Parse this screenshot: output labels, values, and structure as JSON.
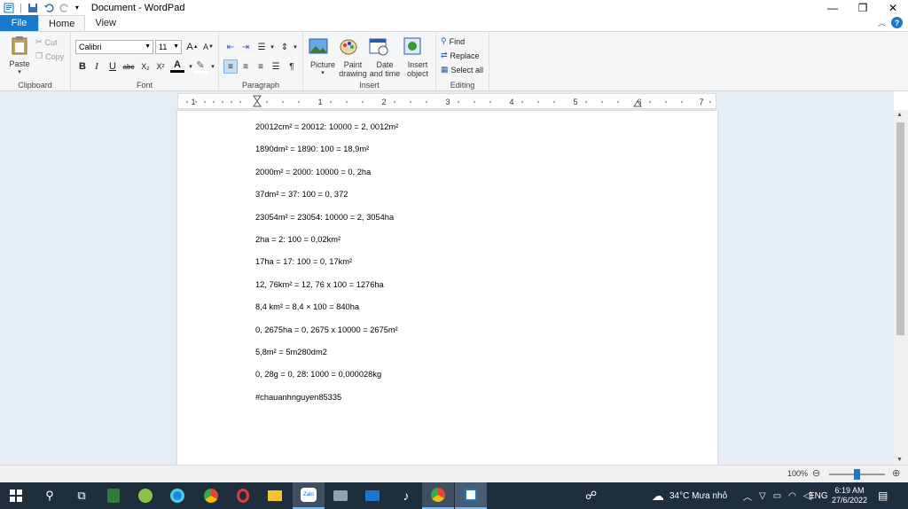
{
  "window": {
    "title": "Document - WordPad"
  },
  "tabs": {
    "file": "File",
    "home": "Home",
    "view": "View"
  },
  "ribbon": {
    "clipboard": {
      "paste": "Paste",
      "cut": "Cut",
      "copy": "Copy",
      "label": "Clipboard"
    },
    "font": {
      "family": "Calibri",
      "size": "11",
      "label": "Font",
      "bold": "B",
      "italic": "I",
      "underline": "U",
      "strike": "abc",
      "sub": "X₂",
      "sup": "X²",
      "color": "A"
    },
    "paragraph": {
      "label": "Paragraph"
    },
    "insert": {
      "picture": "Picture",
      "paint": "Paint drawing",
      "datetime": "Date and time",
      "object": "Insert object",
      "label": "Insert"
    },
    "editing": {
      "find": "Find",
      "replace": "Replace",
      "select_all": "Select all",
      "label": "Editing"
    }
  },
  "ruler": {
    "marks": [
      "1",
      "1",
      "2",
      "3",
      "4",
      "5",
      "6",
      "7"
    ]
  },
  "document": {
    "lines": [
      "20012cm² = 20012: 10000 = 2, 0012m²",
      "1890dm² = 1890: 100 = 18,9m²",
      "2000m² = 2000: 10000 = 0, 2ha",
      "37dm² = 37: 100 = 0, 372",
      "23054m² = 23054: 10000 = 2, 3054ha",
      "2ha = 2: 100 = 0,02km²",
      "17ha = 17: 100 = 0, 17km²",
      "12, 76km² = 12, 76 x 100 = 1276ha",
      "8,4 km² = 8,4 × 100 = 840ha",
      "0, 2675ha = 0, 2675 x 10000 = 2675m²",
      "5,8m² = 5m280dm2",
      "0, 28g = 0, 28: 1000 = 0,000028kg",
      "#chauanhnguyen85335"
    ]
  },
  "status": {
    "zoom": "100%"
  },
  "taskbar": {
    "weather": "34°C  Mưa nhỏ",
    "lang": "ENG",
    "time": "6:19 AM",
    "date": "27/6/2022"
  }
}
